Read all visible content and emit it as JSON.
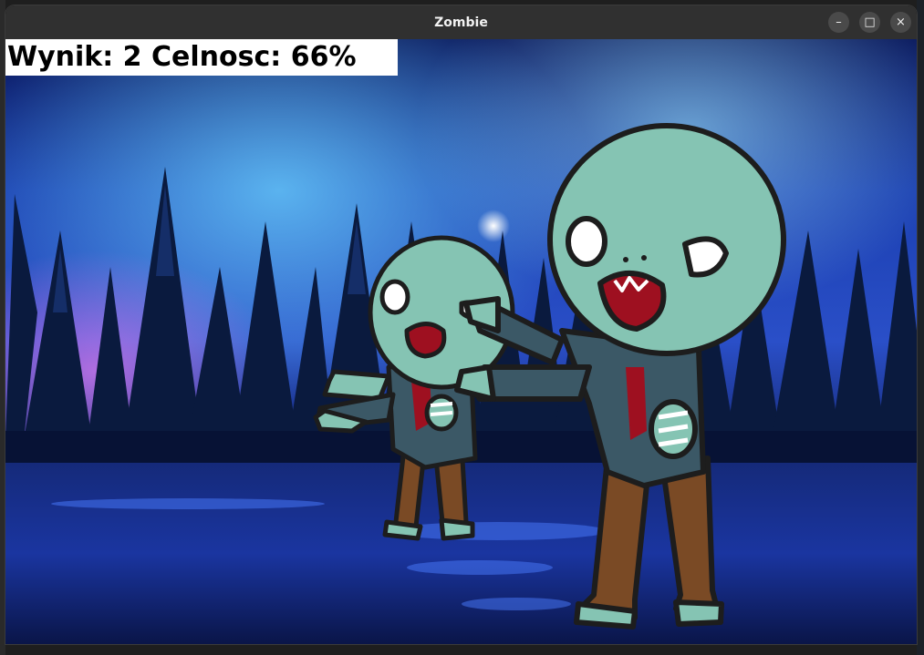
{
  "window": {
    "title": "Zombie",
    "minimize_label": "–",
    "maximize_label": "□",
    "close_label": "×"
  },
  "hud": {
    "text": "Wynik: 2 Celnosc: 66%"
  },
  "colors": {
    "titlebar": "#303030",
    "zombie_skin": "#85c4b3",
    "zombie_shirt": "#3b5866",
    "zombie_pants": "#7a4a25",
    "blood": "#9e1020"
  }
}
